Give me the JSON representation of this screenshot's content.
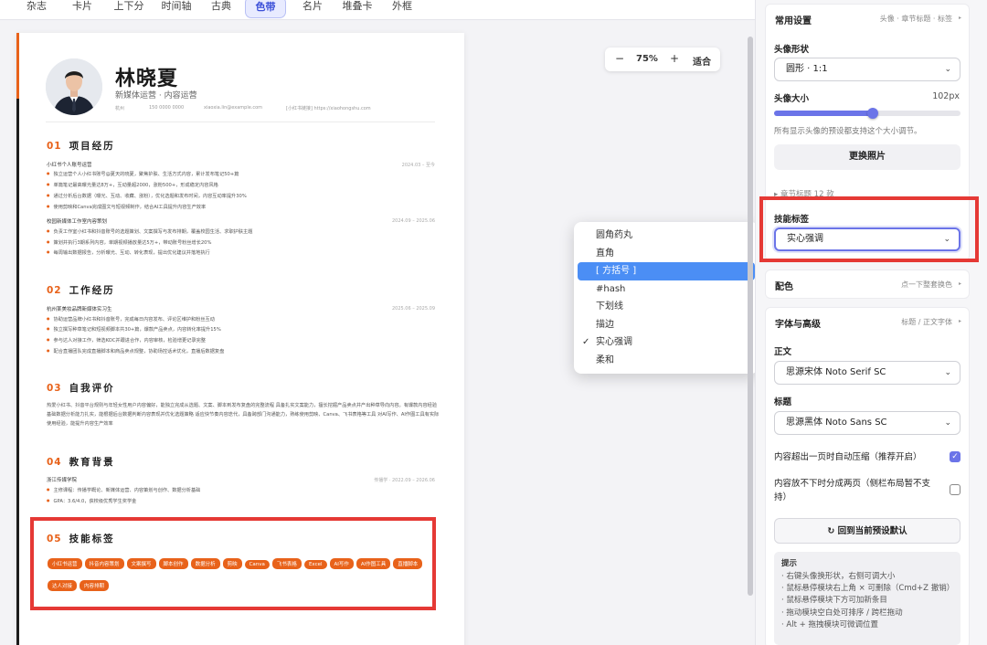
{
  "tabs": [
    {
      "label": "杂志",
      "active": false
    },
    {
      "label": "卡片",
      "active": false
    },
    {
      "label": "上下分",
      "active": false
    },
    {
      "label": "时间轴",
      "active": false
    },
    {
      "label": "古典",
      "active": false
    },
    {
      "label": "色带",
      "active": true
    },
    {
      "label": "名片",
      "active": false
    },
    {
      "label": "堆叠卡",
      "active": false
    },
    {
      "label": "外框",
      "active": false
    }
  ],
  "zoom": {
    "minus": "−",
    "level": "75%",
    "plus": "+",
    "fit": "适合"
  },
  "resume": {
    "name": "林晓夏",
    "title": "新媒体运营 · 内容运营",
    "contacts": [
      "杭州",
      "150 0000 0000",
      "xiaoxia.lin@example.com",
      "[小红书链接] https://xiaohongshu.com"
    ],
    "sections": {
      "projects": {
        "num": "01",
        "title": "项目经历"
      },
      "work": {
        "num": "02",
        "title": "工作经历"
      },
      "eval": {
        "num": "03",
        "title": "自我评价"
      },
      "edu": {
        "num": "04",
        "title": "教育背景"
      },
      "skills": {
        "num": "05",
        "title": "技能标签"
      }
    },
    "project1": {
      "name": "小红书个人账号运营",
      "date": "2024.03 – 至今",
      "bullets": [
        "独立运营个人小红书账号@夏天的晓夏，聚焦护肤、生活方式内容，累计发布笔记50+篇",
        "单篇笔记最高曝光量达8万+，互动量超2000，涨粉500+，形成稳定内容风格",
        "通过分析后台数据（曝光、互动、收藏、涨粉），优化选题和发布时间，内容互动率提升30%",
        "使用剪映和Canva完成图文与短视频制作，结合AI工具提升内容生产效率"
      ]
    },
    "project2": {
      "name": "校园新媒体工作室内容策划",
      "date": "2024.09 – 2025.06",
      "bullets": [
        "负责工作室小红书和抖音账号的选题策划、文案撰写与发布排期，覆盖校园生活、求职护肤主题",
        "策划并执行3期系列内容，单期视频播放量达5万+，带动账号粉丝增长20%",
        "每周输出数据报告，分析曝光、互动、转化表现，提出优化建议并落地执行"
      ]
    },
    "work1": {
      "name": "杭州某美妆品牌新媒体实习生",
      "date": "2025.06 – 2025.09",
      "bullets": [
        "协助运营品牌小红书和抖音账号，完成每日内容发布、评论区维护和粉丝互动",
        "独立撰写种草笔记和短视频脚本共30+篇，爆款产品卖点，内容转化率提升15%",
        "参与达人对接工作，筛选KOC并跟进合作，内容审核，检验增更记录完整",
        "配合直播团队完成直播脚本和商品卖点规整，协助场控话术优化，直播后数据复盘"
      ]
    },
    "eval_text": "热爱小红书、抖音平台规则与年轻女性用户内容偏好，能独立完成从选题、文案、脚本到发布复盘的完整流程 具备扎实文案能力，擅长挖掘产品卖点并产出种草导向内容。有爆款内容经验 基础数据分析能力扎实，能根据后台数据判断内容表现并优化选题策略 适应快节奏内容迭代，具备跨部门沟通能力，熟练使用剪映、Canva、飞书表格等工具 对AI写作、AI作图工具有实际使用经验，能提升内容生产效率",
    "edu1": {
      "name": "浙江传媒学院",
      "date": "传播学 · 2022.09 – 2026.06",
      "bullets": [
        "主修课程：传播学概论、新媒体运营、内容策划与创作、数据分析基础",
        "GPA：3.6/4.0，获校级优秀学生奖学金"
      ]
    },
    "skills": [
      "小红书运营",
      "抖音内容策划",
      "文案撰写",
      "脚本创作",
      "数据分析",
      "剪映",
      "Canva",
      "飞书表格",
      "Excel",
      "AI写作",
      "AI作图工具",
      "直播脚本",
      "达人对接",
      "内容排期"
    ]
  },
  "popup": {
    "options": [
      {
        "label": "圆角药丸",
        "selected": false,
        "checked": false
      },
      {
        "label": "直角",
        "selected": false,
        "checked": false
      },
      {
        "label": "[ 方括号 ]",
        "selected": true,
        "checked": false
      },
      {
        "label": "#hash",
        "selected": false,
        "checked": false
      },
      {
        "label": "下划线",
        "selected": false,
        "checked": false
      },
      {
        "label": "描边",
        "selected": false,
        "checked": false
      },
      {
        "label": "实心强调",
        "selected": false,
        "checked": true
      },
      {
        "label": "柔和",
        "selected": false,
        "checked": false
      }
    ]
  },
  "panel": {
    "common": {
      "title": "常用设置",
      "subtitle": "头像 · 章节标题 · 标签",
      "avatar_shape_label": "头像形状",
      "avatar_shape_value": "圆形 · 1:1",
      "avatar_size_label": "头像大小",
      "avatar_size_value": "102px",
      "avatar_size_fraction": 0.53,
      "avatar_hint": "所有显示头像的预设都支持这个大小调节。",
      "replace_photo": "更换照片",
      "section_title_collapsed": "章节标题 12 款",
      "skill_tag_label": "技能标签",
      "skill_tag_value": "实心强调"
    },
    "color": {
      "title": "配色",
      "subtitle": "点一下整套换色"
    },
    "font": {
      "title": "字体与高级",
      "subtitle": "标题 / 正文字体",
      "body_label": "正文",
      "body_value": "思源宋体 Noto Serif SC",
      "heading_label": "标题",
      "heading_value": "思源黑体 Noto Sans SC",
      "auto_compress": "内容超出一页时自动压缩（推荐开启）",
      "auto_compress_checked": true,
      "split_two": "内容放不下时分成两页（侧栏布局暂不支持）",
      "split_two_checked": false,
      "reset": "↻ 回到当前预设默认"
    },
    "tips": {
      "title": "提示",
      "items": [
        "· 右键头像换形状，右侧可调大小",
        "· 鼠标悬停模块右上角 × 可删除（Cmd+Z 撤销）",
        "· 鼠标悬停模块下方可加新条目",
        "· 拖动模块空白处可排序 / 跨栏拖动",
        "· Alt + 拖拽模块可微调位置"
      ]
    }
  }
}
